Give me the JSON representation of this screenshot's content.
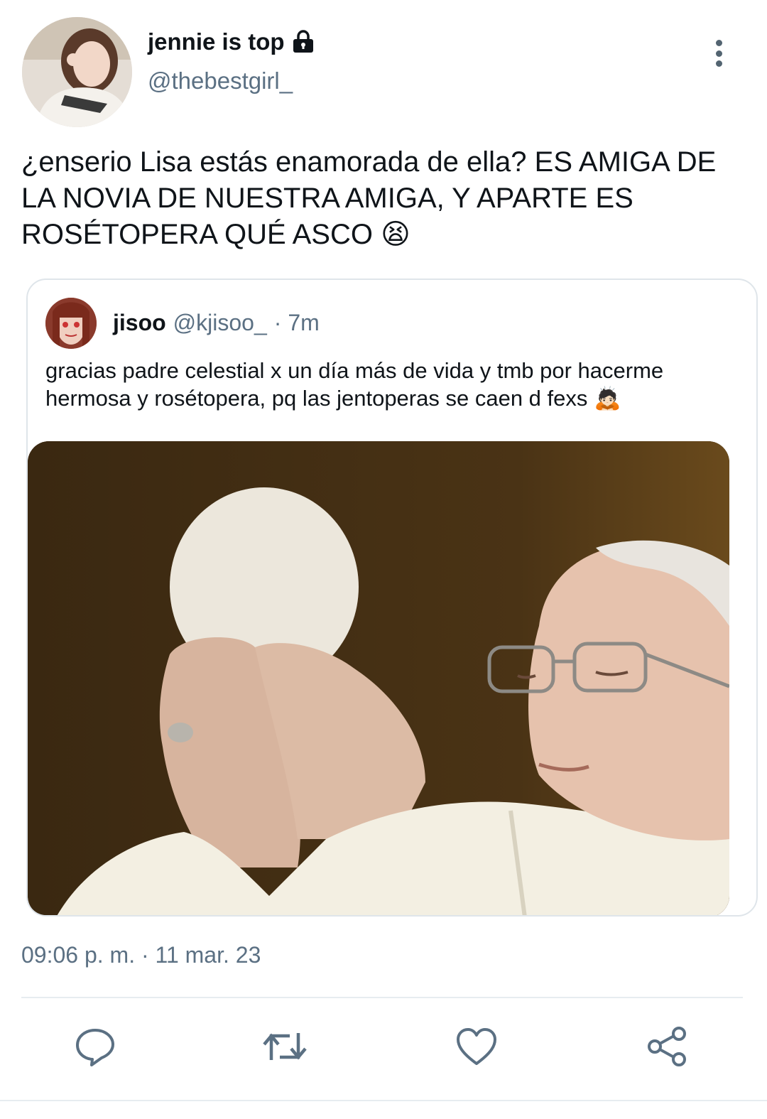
{
  "tweet": {
    "display_name": "jennie is top",
    "handle": "@thebestgirl_",
    "text": "¿enserio Lisa estás enamorada de ella? ES AMIGA DE LA NOVIA DE NUESTRA AMIGA, Y APARTE ES ROSÉTOPERA QUÉ ASCO 😫",
    "timestamp": "09:06 p. m. · 11 mar. 23"
  },
  "quote": {
    "display_name": "jisoo",
    "handle": "@kjisoo_",
    "time": "· 7m",
    "text": "gracias padre celestial x un día más de vida y tmb por hacerme hermosa y rosétopera, pq las jentoperas se caen d fexs 🙇🏻"
  },
  "icons": {
    "lock": "lock-icon",
    "more": "more-vertical-icon",
    "reply": "reply-icon",
    "retweet": "retweet-icon",
    "like": "heart-icon",
    "share": "share-icon"
  },
  "colors": {
    "text": "#0f1419",
    "secondary": "#5b7083",
    "border": "#dfe5ea"
  }
}
